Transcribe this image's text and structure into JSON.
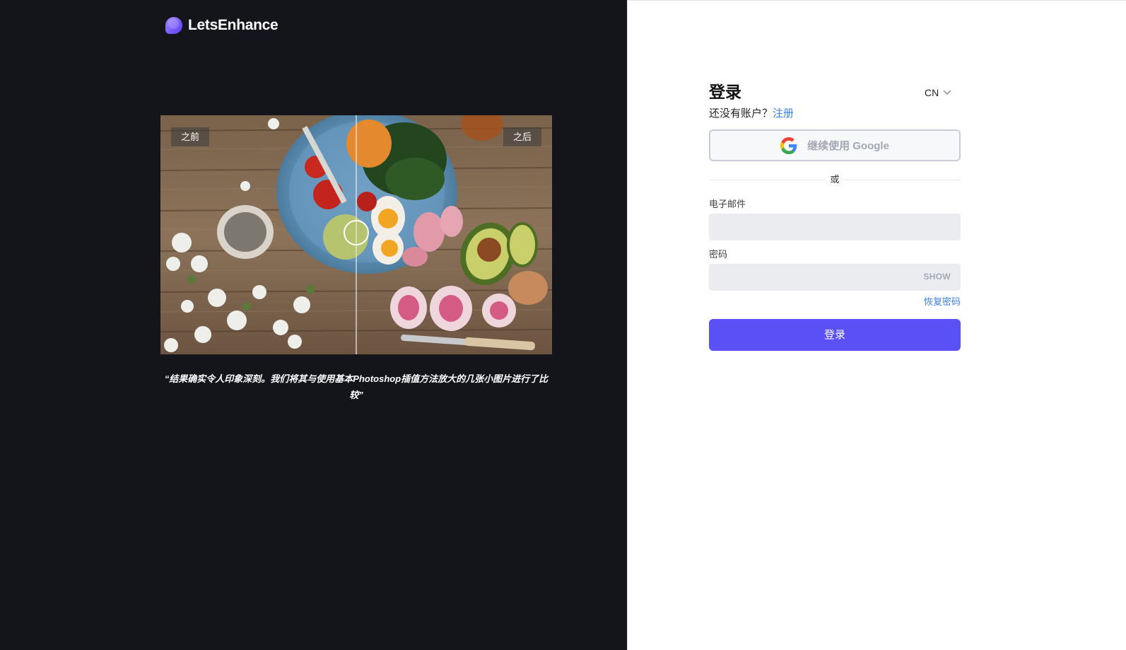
{
  "brand": {
    "name": "LetsEnhance",
    "icon": "letsenhance-logo-icon",
    "accent": "#7b5cff"
  },
  "compare": {
    "before_label": "之前",
    "after_label": "之后",
    "handle_icon": "circle-handle-icon"
  },
  "testimonial": {
    "quote": "“结果确实令人印象深刻。我们将其与使用基本Photoshop插值方法放大的几张小图片进行了比较”"
  },
  "login": {
    "title": "登录",
    "language": "CN",
    "language_icon": "chevron-down-icon",
    "no_account_text": "还没有账户？",
    "signup_link": "注册",
    "google_button": "继续使用 Google",
    "google_icon": "google-g-icon",
    "divider_text": "或",
    "email_label": "电子邮件",
    "email_value": "",
    "password_label": "密码",
    "password_value": "",
    "show_label": "SHOW",
    "recover_link": "恢复密码",
    "submit_label": "登录"
  },
  "colors": {
    "left_bg": "#14151b",
    "primary_button": "#5b50f6",
    "link": "#3b7ee8",
    "input_bg": "#ebecf0"
  }
}
